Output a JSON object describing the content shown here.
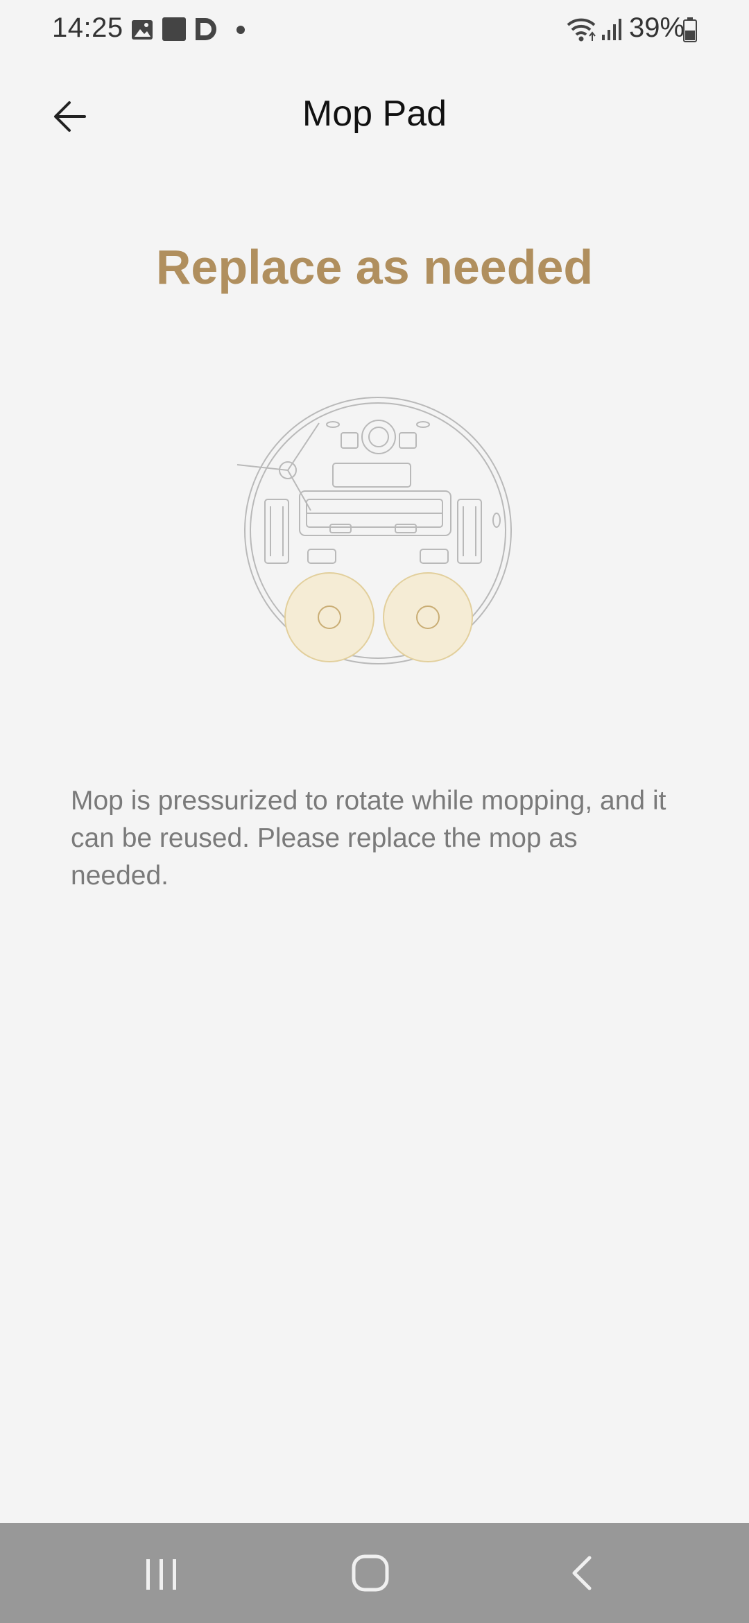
{
  "status_bar": {
    "time": "14:25",
    "battery": "39%",
    "icons": [
      "gallery-icon",
      "square-notification-icon",
      "d-app-icon",
      "dot-icon",
      "wifi-icon",
      "signal-icon",
      "battery-icon"
    ]
  },
  "header": {
    "title": "Mop Pad",
    "back_icon": "arrow-left-icon"
  },
  "main": {
    "headline": "Replace as needed",
    "illustration": "robot-vacuum-bottom-mop-pads",
    "description": "Mop is pressurized to rotate while mopping, and it can be reused. Please replace the mop as needed."
  },
  "nav_bar": {
    "buttons": [
      "recent-apps-icon",
      "home-icon",
      "back-icon"
    ]
  },
  "colors": {
    "background": "#f4f4f4",
    "accent": "#b08f5e",
    "mop_fill": "#f5ecd5",
    "nav_bar": "#989898"
  }
}
